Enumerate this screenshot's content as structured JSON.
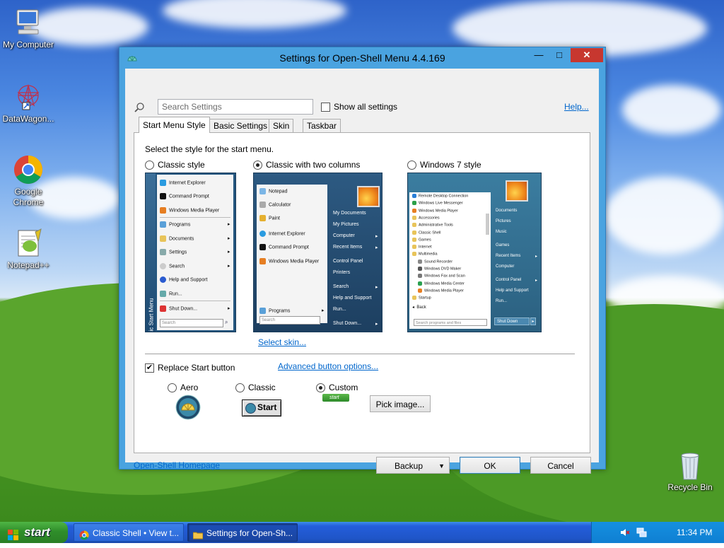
{
  "desktop": {
    "icons": [
      {
        "label": "My Computer"
      },
      {
        "label": "DataWagon..."
      },
      {
        "label": "Google Chrome"
      },
      {
        "label": "Notepad++"
      },
      {
        "label": "Recycle Bin"
      }
    ]
  },
  "window": {
    "title": "Settings for Open-Shell Menu 4.4.169",
    "min_glyph": "▭",
    "max_glyph": "□",
    "close_glyph": "✕",
    "search_placeholder": "Search Settings",
    "show_all_label": "Show all settings",
    "help_link": "Help...",
    "tabs": [
      {
        "label": "Start Menu Style",
        "active": true
      },
      {
        "label": "Basic Settings",
        "active": false
      },
      {
        "label": "Skin",
        "active": false
      },
      {
        "label": "Taskbar",
        "active": false
      }
    ],
    "heading": "Select the style for the start menu.",
    "styles": [
      {
        "label": "Classic style",
        "selected": false
      },
      {
        "label": "Classic with two columns",
        "selected": true
      },
      {
        "label": "Windows 7 style",
        "selected": false
      }
    ],
    "classic_preview": {
      "side_label": "Classic Start Menu",
      "items": [
        "Internet Explorer",
        "Command Prompt",
        "Windows Media Player",
        "Programs",
        "Documents",
        "Settings",
        "Search",
        "Help and Support",
        "Run...",
        "Shut Down..."
      ],
      "search": "Search"
    },
    "two_col_preview": {
      "left_items": [
        "Notepad",
        "Calculator",
        "Paint",
        "Internet Explorer",
        "Command Prompt",
        "Windows Media Player"
      ],
      "programs": "Programs",
      "right_items": [
        "My Documents",
        "My Pictures",
        "Computer",
        "Recent Items",
        "Control Panel",
        "Printers",
        "Search",
        "Help and Support",
        "Run...",
        "Shut Down..."
      ],
      "search": "Search"
    },
    "win7_preview": {
      "left_items": [
        "Remote Desktop Connection",
        "Windows Live Messenger",
        "Windows Media Player",
        "Accessories",
        "Administrative Tools",
        "Classic Shell",
        "Games",
        "Internet",
        "Multimedia",
        "Sound Recorder",
        "Windows DVD Maker",
        "Windows Fax and Scan",
        "Windows Media Center",
        "Windows Media Player",
        "Startup"
      ],
      "back": "Back",
      "search": "Search programs and files",
      "right_items": [
        "Documents",
        "Pictures",
        "Music",
        "Games",
        "Recent Items",
        "Computer",
        "Control Panel",
        "Help and Support",
        "Run...",
        "Shut Down"
      ]
    },
    "select_skin_link": "Select skin...",
    "replace_start_label": "Replace Start button",
    "replace_start_checked": true,
    "advanced_button_link": "Advanced button options...",
    "button_styles": [
      {
        "label": "Aero",
        "selected": false
      },
      {
        "label": "Classic",
        "selected": false
      },
      {
        "label": "Custom",
        "selected": true
      }
    ],
    "classic_button_text": "Start",
    "custom_button_text": "start",
    "pick_image_label": "Pick image...",
    "homepage_link": "Open-Shell Homepage",
    "backup_label": "Backup",
    "ok_label": "OK",
    "cancel_label": "Cancel"
  },
  "taskbar": {
    "start_label": "start",
    "tasks": [
      {
        "label": "Classic Shell • View t..."
      },
      {
        "label": "Settings for Open-Sh..."
      }
    ],
    "clock": "11:34 PM"
  }
}
